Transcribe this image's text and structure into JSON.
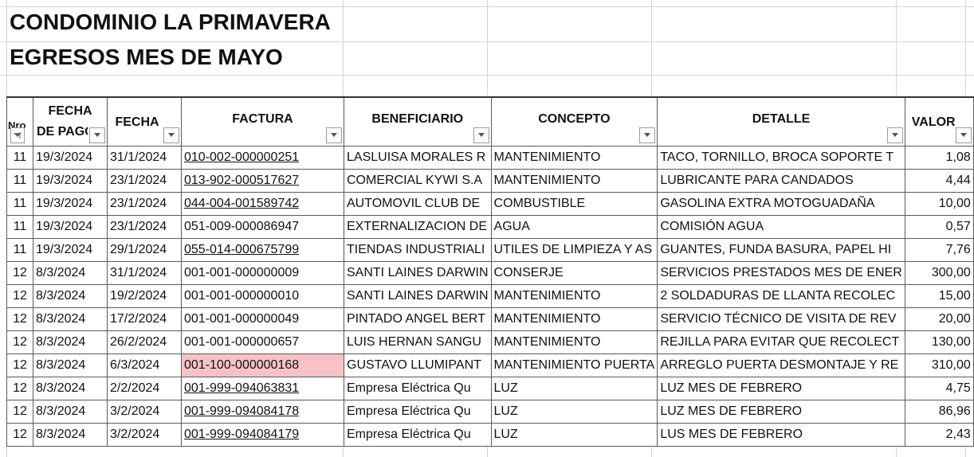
{
  "title_line1": "CONDOMINIO LA PRIMAVERA",
  "title_line2": "EGRESOS MES DE MAYO",
  "headers": {
    "nro": "Nro",
    "fecha_pago_1": "FECHA",
    "fecha_pago_2": "DE PAGO",
    "fecha": "FECHA",
    "factura": "FACTURA",
    "beneficiario": "BENEFICIARIO",
    "concepto": "CONCEPTO",
    "detalle": "DETALLE",
    "valor": "VALOR"
  },
  "colors": {
    "link": "#4a78a8",
    "highlight_fill": "#f6c2c6",
    "highlight_text": "#b41a1a"
  },
  "rows": [
    {
      "nro": "11",
      "fecha_pago": "19/3/2024",
      "fecha": "31/1/2024",
      "factura": "010-002-000000251",
      "factura_link": true,
      "beneficiario": "LASLUISA MORALES R",
      "concepto": "MANTENIMIENTO",
      "detalle": "TACO, TORNILLO, BROCA SOPORTE T",
      "valor": "1,08"
    },
    {
      "nro": "11",
      "fecha_pago": "19/3/2024",
      "fecha": "23/1/2024",
      "factura": "013-902-000517627",
      "factura_link": true,
      "beneficiario": "COMERCIAL KYWI S.A",
      "concepto": "MANTENIMIENTO",
      "detalle": "LUBRICANTE PARA CANDADOS",
      "valor": "4,44"
    },
    {
      "nro": "11",
      "fecha_pago": "19/3/2024",
      "fecha": "23/1/2024",
      "factura": "044-004-001589742",
      "factura_link": true,
      "beneficiario": "AUTOMOVIL CLUB DE",
      "concepto": "COMBUSTIBLE",
      "detalle": "GASOLINA EXTRA MOTOGUADAÑA",
      "valor": "10,00"
    },
    {
      "nro": "11",
      "fecha_pago": "19/3/2024",
      "fecha": "23/1/2024",
      "factura": "051-009-000086947",
      "factura_link": false,
      "beneficiario": "EXTERNALIZACION DE",
      "concepto": "AGUA",
      "detalle": "COMISIÓN AGUA",
      "valor": "0,57"
    },
    {
      "nro": "11",
      "fecha_pago": "19/3/2024",
      "fecha": "29/1/2024",
      "factura": "055-014-000675799",
      "factura_link": true,
      "beneficiario": "TIENDAS INDUSTRIALI",
      "concepto": "UTILES DE LIMPIEZA Y AS",
      "detalle": "GUANTES, FUNDA BASURA, PAPEL HI",
      "valor": "7,76"
    },
    {
      "nro": "12",
      "fecha_pago": "8/3/2024",
      "fecha": "31/1/2024",
      "factura": "001-001-000000009",
      "factura_link": false,
      "beneficiario": "SANTI LAINES DARWIN",
      "concepto": "CONSERJE",
      "detalle": "SERVICIOS PRESTADOS MES DE ENER",
      "valor": "300,00"
    },
    {
      "nro": "12",
      "fecha_pago": "8/3/2024",
      "fecha": "19/2/2024",
      "factura": "001-001-000000010",
      "factura_link": false,
      "beneficiario": "SANTI LAINES DARWIN",
      "concepto": "MANTENIMIENTO",
      "detalle": "2 SOLDADURAS DE LLANTA RECOLEC",
      "valor": "15,00"
    },
    {
      "nro": "12",
      "fecha_pago": "8/3/2024",
      "fecha": "17/2/2024",
      "factura": "001-001-000000049",
      "factura_link": false,
      "beneficiario": "PINTADO ANGEL BERT",
      "concepto": "MANTENIMIENTO",
      "detalle": "SERVICIO TÉCNICO DE VISITA DE REV",
      "valor": "20,00"
    },
    {
      "nro": "12",
      "fecha_pago": "8/3/2024",
      "fecha": "26/2/2024",
      "factura": "001-001-000000657",
      "factura_link": false,
      "beneficiario": "LUIS HERNAN SANGU",
      "concepto": "MANTENIMIENTO",
      "detalle": "REJILLA PARA EVITAR QUE RECOLECT",
      "valor": "130,00"
    },
    {
      "nro": "12",
      "fecha_pago": "8/3/2024",
      "fecha": "6/3/2024",
      "factura": "001-100-000000168",
      "factura_link": false,
      "factura_highlight": true,
      "beneficiario": "GUSTAVO LLUMIPANT",
      "concepto": "MANTENIMIENTO PUERTA",
      "detalle": "ARREGLO PUERTA DESMONTAJE Y RE",
      "valor": "310,00"
    },
    {
      "nro": "12",
      "fecha_pago": "8/3/2024",
      "fecha": "2/2/2024",
      "factura": "001-999-094063831",
      "factura_link": true,
      "beneficiario": "Empresa Eléctrica Qu",
      "concepto": "LUZ",
      "detalle": "LUZ MES DE FEBRERO",
      "valor": "4,75"
    },
    {
      "nro": "12",
      "fecha_pago": "8/3/2024",
      "fecha": "3/2/2024",
      "factura": "001-999-094084178",
      "factura_link": true,
      "beneficiario": "Empresa Eléctrica Qu",
      "concepto": "LUZ",
      "detalle": "LUZ MES DE FEBRERO",
      "valor": "86,96"
    },
    {
      "nro": "12",
      "fecha_pago": "8/3/2024",
      "fecha": "3/2/2024",
      "factura": "001-999-094084179",
      "factura_link": true,
      "beneficiario": "Empresa Eléctrica Qu",
      "concepto": "LUZ",
      "detalle": "LUS MES DE FEBRERO",
      "valor": "2,43"
    }
  ]
}
